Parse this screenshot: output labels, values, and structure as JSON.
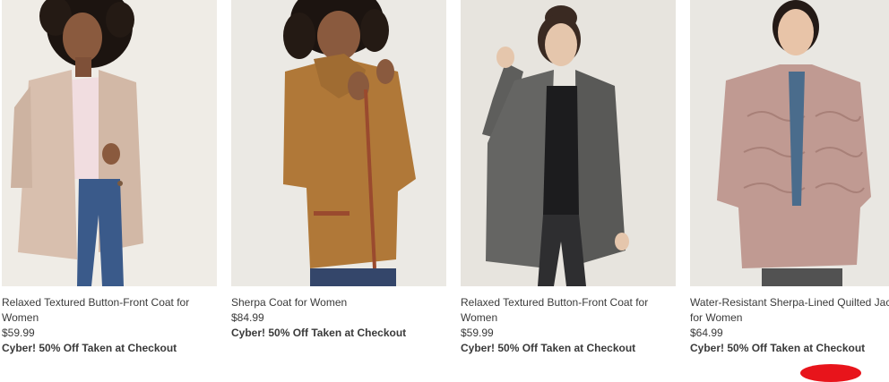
{
  "products": [
    {
      "name": "Relaxed Textured Button-Front Coat for Women",
      "price": "$59.99",
      "promo": "Cyber! 50% Off Taken at Checkout",
      "colors": {
        "background": "#efece6",
        "coat": "#d8bfae",
        "top": "#f1dde0",
        "pants": "#3a5a8a",
        "skin": "#8a5a3e",
        "hair": "#1c1410"
      }
    },
    {
      "name": "Sherpa Coat for Women",
      "price": "$84.99",
      "promo": "Cyber! 50% Off Taken at Checkout",
      "colors": {
        "background": "#ebe9e4",
        "coat": "#b07838",
        "trim": "#9a4a2e",
        "pants": "#34466a",
        "skin": "#8a5a3e",
        "hair": "#1c1410"
      }
    },
    {
      "name": "Relaxed Textured Button-Front Coat for Women",
      "price": "$59.99",
      "promo": "Cyber! 50% Off Taken at Checkout",
      "colors": {
        "background": "#e7e4de",
        "coat": "#5e5e5c",
        "top": "#1c1c1e",
        "pants": "#2e2e30",
        "skin": "#e5c6ac",
        "hair": "#3a2a22"
      }
    },
    {
      "name": "Water-Resistant Sherpa-Lined Quilted Jacket for Women",
      "price": "$64.99",
      "promo": "Cyber! 50% Off Taken at Checkout",
      "colors": {
        "background": "#e9e7e2",
        "coat": "#c09a92",
        "top": "#4a6c8c",
        "pants": "#525252",
        "skin": "#e8c4a8",
        "hair": "#241a16"
      }
    }
  ],
  "badge": {
    "color": "#e8141b"
  }
}
